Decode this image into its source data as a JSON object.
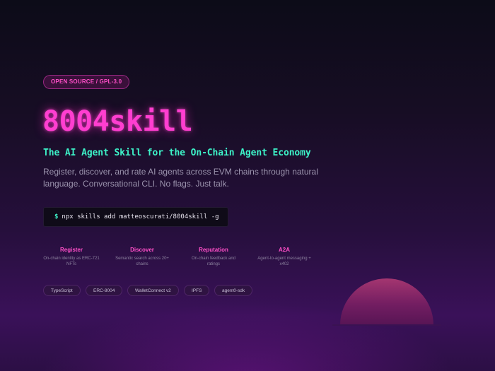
{
  "badge": "OPEN SOURCE / GPL-3.0",
  "hero": {
    "title": "8004skill",
    "tagline": "The AI Agent Skill for the On-Chain Agent Economy",
    "description": "Register, discover, and rate AI agents across EVM chains through natural language. Conversational CLI. No flags. Just talk."
  },
  "command": {
    "prompt": "$",
    "text": "npx skills add matteoscurati/8004skill -g"
  },
  "features": [
    {
      "title": "Register",
      "description": "On-chain identity as ERC-721 NFTs"
    },
    {
      "title": "Discover",
      "description": "Semantic search across 20+ chains"
    },
    {
      "title": "Reputation",
      "description": "On-chain feedback and ratings"
    },
    {
      "title": "A2A",
      "description": "Agent-to-agent messaging + x402"
    }
  ],
  "tags": [
    "TypeScript",
    "ERC-8004",
    "WalletConnect v2",
    "IPFS",
    "agent0-sdk"
  ],
  "colors": {
    "accent_pink": "#ff3ed0",
    "accent_teal": "#3df2c8",
    "background_top": "#0c0c18",
    "background_bottom": "#3a1159"
  }
}
